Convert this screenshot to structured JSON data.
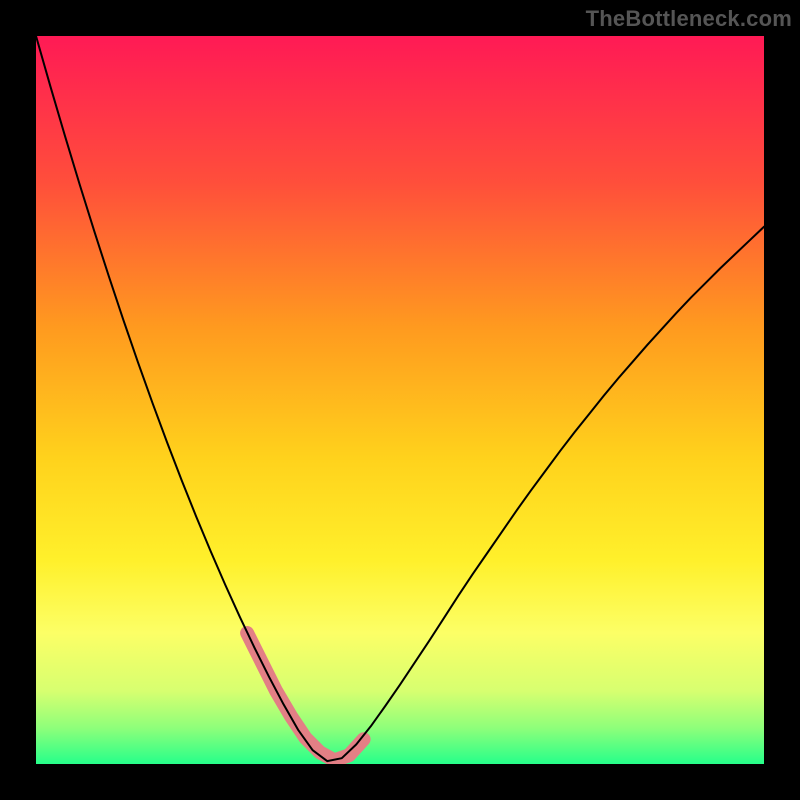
{
  "watermark": "TheBottleneck.com",
  "chart_data": {
    "type": "line",
    "title": "",
    "xlabel": "",
    "ylabel": "",
    "xlim": [
      0,
      100
    ],
    "ylim": [
      0,
      100
    ],
    "grid": false,
    "legend": false,
    "series": [
      {
        "name": "curve",
        "color": "#000000",
        "x": [
          0,
          2,
          4,
          6,
          8,
          10,
          12,
          14,
          16,
          18,
          20,
          22,
          24,
          26,
          28,
          30,
          32,
          34,
          36,
          38,
          40,
          42,
          44,
          46,
          48,
          50,
          52,
          54,
          56,
          58,
          60,
          62,
          64,
          66,
          68,
          70,
          72,
          74,
          76,
          78,
          80,
          82,
          84,
          86,
          88,
          90,
          92,
          94,
          96,
          98,
          100
        ],
        "y": [
          100,
          93,
          86.2,
          79.6,
          73.2,
          67,
          61,
          55.2,
          49.6,
          44.2,
          39,
          34,
          29.2,
          24.6,
          20.2,
          16,
          12,
          8.2,
          4.7,
          1.9,
          0.4,
          0.8,
          2.7,
          5.2,
          8,
          10.9,
          13.9,
          16.9,
          20,
          23.1,
          26.1,
          29,
          31.9,
          34.8,
          37.6,
          40.3,
          43,
          45.6,
          48.1,
          50.6,
          53,
          55.3,
          57.6,
          59.8,
          62,
          64.1,
          66.1,
          68.1,
          70,
          71.9,
          73.8
        ]
      },
      {
        "name": "highlight-band",
        "color": "#e37f85",
        "thickness": 14,
        "x": [
          29,
          31,
          33,
          35,
          37,
          39,
          41,
          43,
          45
        ],
        "y": [
          18,
          14,
          10,
          6.6,
          3.6,
          1.6,
          0.5,
          1.2,
          3.4
        ]
      }
    ],
    "background_gradient": {
      "type": "vertical",
      "stops": [
        {
          "offset": 0.0,
          "color": "#ff1a55"
        },
        {
          "offset": 0.2,
          "color": "#ff4e3b"
        },
        {
          "offset": 0.4,
          "color": "#ff9a1f"
        },
        {
          "offset": 0.58,
          "color": "#ffd21c"
        },
        {
          "offset": 0.72,
          "color": "#fff02b"
        },
        {
          "offset": 0.82,
          "color": "#fcff66"
        },
        {
          "offset": 0.9,
          "color": "#d7ff70"
        },
        {
          "offset": 0.95,
          "color": "#8fff7a"
        },
        {
          "offset": 1.0,
          "color": "#26ff8a"
        }
      ]
    }
  }
}
